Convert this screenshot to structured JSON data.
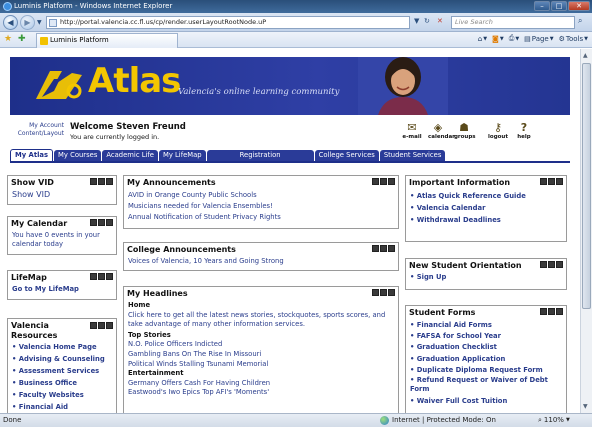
{
  "window": {
    "title": "Luminis Platform - Windows Internet Explorer",
    "controls": [
      "minimize",
      "maximize",
      "close"
    ]
  },
  "address": {
    "url": "http://portal.valencia.cc.fl.us/cp/render.userLayoutRootNode.uP",
    "search_placeholder": "Live Search"
  },
  "favbar": {
    "tab_label": "Luminis Platform",
    "tools": [
      {
        "icon": "home-icon",
        "label": ""
      },
      {
        "icon": "feeds-icon",
        "label": ""
      },
      {
        "icon": "print-icon",
        "label": ""
      },
      {
        "icon": "page-icon",
        "label": "Page"
      },
      {
        "icon": "tools-icon",
        "label": "Tools"
      }
    ]
  },
  "banner": {
    "logo_text": "Atlas",
    "tagline": "Valencia's online learning community"
  },
  "user": {
    "my_account": "My Account",
    "content_layout": "Content/Layout",
    "welcome": "Welcome Steven Freund",
    "status": "You are currently logged in."
  },
  "quick_icons": [
    {
      "label": "e-mail",
      "icon": "email-icon"
    },
    {
      "label": "calendar",
      "icon": "calendar-icon"
    },
    {
      "label": "groups",
      "icon": "groups-icon"
    },
    {
      "label": "logout",
      "icon": "logout-icon"
    },
    {
      "label": "help",
      "icon": "help-icon"
    }
  ],
  "nav_tabs": [
    {
      "label": "My Atlas",
      "active": true
    },
    {
      "label": "My Courses"
    },
    {
      "label": "Academic Life"
    },
    {
      "label": "My LifeMap"
    },
    {
      "label": "Registration"
    },
    {
      "label": "College Services"
    },
    {
      "label": "Student Services"
    }
  ],
  "portlets": {
    "show_vid": {
      "title": "Show VID",
      "link": "Show VID"
    },
    "calendar": {
      "title": "My Calendar",
      "text": "You have 0 events in your calendar today"
    },
    "lifemap": {
      "title": "LifeMap",
      "link": "Go to My LifeMap"
    },
    "resources": {
      "title": "Valencia Resources",
      "items": [
        "Valencia Home Page",
        "Advising & Counseling",
        "Assessment Services",
        "Business Office",
        "Faculty Websites",
        "Financial Aid"
      ]
    },
    "announcements": {
      "title": "My Announcements",
      "items": [
        "AVID in Orange County Public Schools",
        "Musicians needed for Valencia Ensembles!",
        "Annual Notification of Student Privacy Rights"
      ]
    },
    "college_ann": {
      "title": "College Announcements",
      "items": [
        "Voices of Valencia, 10 Years and Going Strong"
      ]
    },
    "headlines": {
      "title": "My Headlines",
      "home_label": "Home",
      "home_text": "Click here to get all the latest news stories, stockquotes, sports scores, and take advantage of many other information services.",
      "top_label": "Top Stories",
      "top_items": [
        "N.O. Police Officers Indicted",
        "Gambling Bans On The Rise In Missouri",
        "Political Winds Stalling Tsunami Memorial"
      ],
      "ent_label": "Entertainment",
      "ent_items": [
        "Germany Offers Cash For Having Children",
        "Eastwood's Iwo Epics Top AFI's 'Moments'"
      ]
    },
    "important": {
      "title": "Important Information",
      "items": [
        "Atlas Quick Reference Guide",
        "Valencia Calendar",
        "Withdrawal Deadlines"
      ]
    },
    "orientation": {
      "title": "New Student Orientation",
      "items": [
        "Sign Up"
      ]
    },
    "forms": {
      "title": "Student Forms",
      "items": [
        "Financial Aid Forms",
        "FAFSA for School Year",
        "Graduation Checklist",
        "Graduation Application",
        "Duplicate Diploma Request Form",
        "Refund Request or Waiver of Debt Form",
        "Waiver Full Cost Tuition"
      ]
    }
  },
  "status": {
    "left": "Done",
    "zone": "Internet | Protected Mode: On",
    "zoom": "110%"
  }
}
